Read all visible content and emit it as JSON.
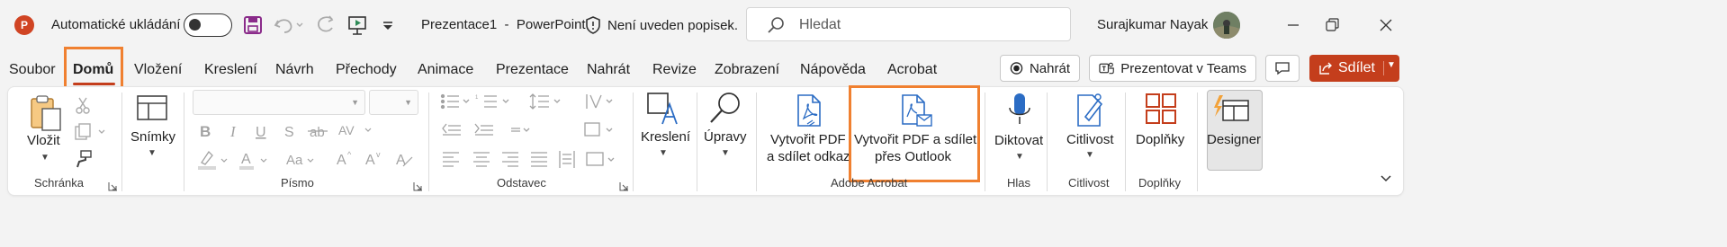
{
  "titlebar": {
    "app_icon_text": "P",
    "autosave_label": "Automatické ukládání",
    "autosave_on": false,
    "doc_title": "Prezentace1  -  PowerPoint",
    "sensitivity_status": "Není uveden popisek.",
    "search_placeholder": "Hledat",
    "user_name": "Surajkumar Nayak"
  },
  "tabs": [
    "Soubor",
    "Domů",
    "Vložení",
    "Kreslení",
    "Návrh",
    "Přechody",
    "Animace",
    "Prezentace",
    "Nahrát",
    "Revize",
    "Zobrazení",
    "Nápověda",
    "Acrobat"
  ],
  "active_tab": "Domů",
  "right_actions": {
    "record_label": "Nahrát",
    "teams_label": "Prezentovat v Teams",
    "share_label": "Sdílet"
  },
  "ribbon": {
    "clipboard": {
      "paste_label": "Vložit",
      "group_label": "Schránka"
    },
    "slides": {
      "label": "Snímky"
    },
    "font": {
      "group_label": "Písmo"
    },
    "paragraph": {
      "group_label": "Odstavec"
    },
    "drawing": {
      "label": "Kreslení"
    },
    "editing": {
      "label": "Úpravy"
    },
    "adobe": {
      "create_share_link_l1": "Vytvořit PDF",
      "create_share_link_l2": "a sdílet odkaz",
      "create_share_outlook_l1": "Vytvořit PDF a sdílet",
      "create_share_outlook_l2": "přes Outlook",
      "group_label": "Adobe Acrobat"
    },
    "voice": {
      "dictate_label": "Diktovat",
      "group_label": "Hlas"
    },
    "sensitivity": {
      "label": "Citlivost",
      "group_label": "Citlivost"
    },
    "addins": {
      "label": "Doplňky",
      "group_label": "Doplňky"
    },
    "designer": {
      "label": "Designer"
    }
  },
  "colors": {
    "accent": "#c43e1c",
    "highlight": "#f08030",
    "icon_blue": "#2b6cc4"
  },
  "icons": [
    "powerpoint-logo-icon",
    "save-icon",
    "undo-icon",
    "redo-icon",
    "start-from-beginning-icon",
    "customize-qat-icon",
    "shield-icon",
    "search-icon",
    "minimize-icon",
    "restore-icon",
    "close-icon",
    "record-icon",
    "teams-icon",
    "comments-icon",
    "share-icon",
    "paste-icon",
    "cut-icon",
    "copy-icon",
    "format-painter-icon",
    "layout-icon",
    "shapes-icon",
    "find-icon",
    "pdf-link-icon",
    "pdf-mail-icon",
    "microphone-icon",
    "sensitivity-icon",
    "addins-icon",
    "designer-icon",
    "collapse-ribbon-icon"
  ]
}
